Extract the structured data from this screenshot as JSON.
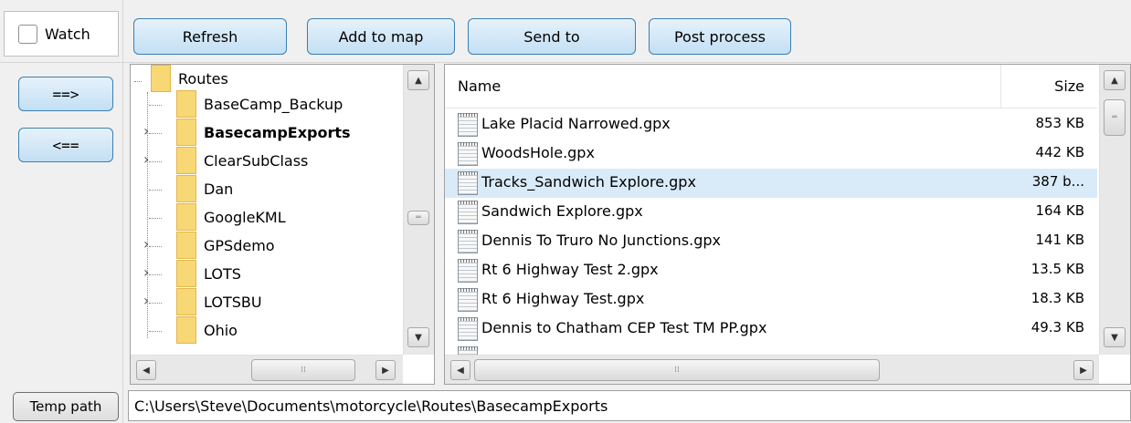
{
  "toolbar": {
    "watch_label": "Watch",
    "refresh_label": "Refresh",
    "add_to_map_label": "Add to map",
    "send_to_label": "Send to",
    "post_process_label": "Post process"
  },
  "side": {
    "forward_label": "==>",
    "back_label": "<=="
  },
  "tree": {
    "root": "Routes",
    "items": [
      {
        "label": "BaseCamp_Backup",
        "expandable": false,
        "bold": false
      },
      {
        "label": "BasecampExports",
        "expandable": true,
        "bold": true
      },
      {
        "label": "ClearSubClass",
        "expandable": true,
        "bold": false
      },
      {
        "label": "Dan",
        "expandable": false,
        "bold": false
      },
      {
        "label": "GoogleKML",
        "expandable": false,
        "bold": false
      },
      {
        "label": "GPSdemo",
        "expandable": true,
        "bold": false
      },
      {
        "label": "LOTS",
        "expandable": true,
        "bold": false
      },
      {
        "label": "LOTSBU",
        "expandable": true,
        "bold": false
      },
      {
        "label": "Ohio",
        "expandable": false,
        "bold": false
      }
    ]
  },
  "files": {
    "col_name": "Name",
    "col_size": "Size",
    "rows": [
      {
        "name": "Lake Placid Narrowed.gpx",
        "size": "853 KB"
      },
      {
        "name": "WoodsHole.gpx",
        "size": "442 KB"
      },
      {
        "name": "Tracks_Sandwich Explore.gpx",
        "size": "387 b..."
      },
      {
        "name": "Sandwich Explore.gpx",
        "size": "164 KB"
      },
      {
        "name": "Dennis To Truro No Junctions.gpx",
        "size": "141 KB"
      },
      {
        "name": "Rt 6 Highway Test 2.gpx",
        "size": "13.5 KB"
      },
      {
        "name": "Rt 6 Highway Test.gpx",
        "size": "18.3 KB"
      },
      {
        "name": "Dennis to Chatham CEP Test TM PP.gpx",
        "size": "49.3 KB"
      }
    ],
    "selected_index": 2
  },
  "footer": {
    "temp_path_label": "Temp path",
    "path_value": "C:\\Users\\Steve\\Documents\\motorcycle\\Routes\\BasecampExports"
  },
  "colors": {
    "selection": "#d9ebf9",
    "folder": "#f8d775",
    "button_border_blue": "#3c7fb1"
  }
}
